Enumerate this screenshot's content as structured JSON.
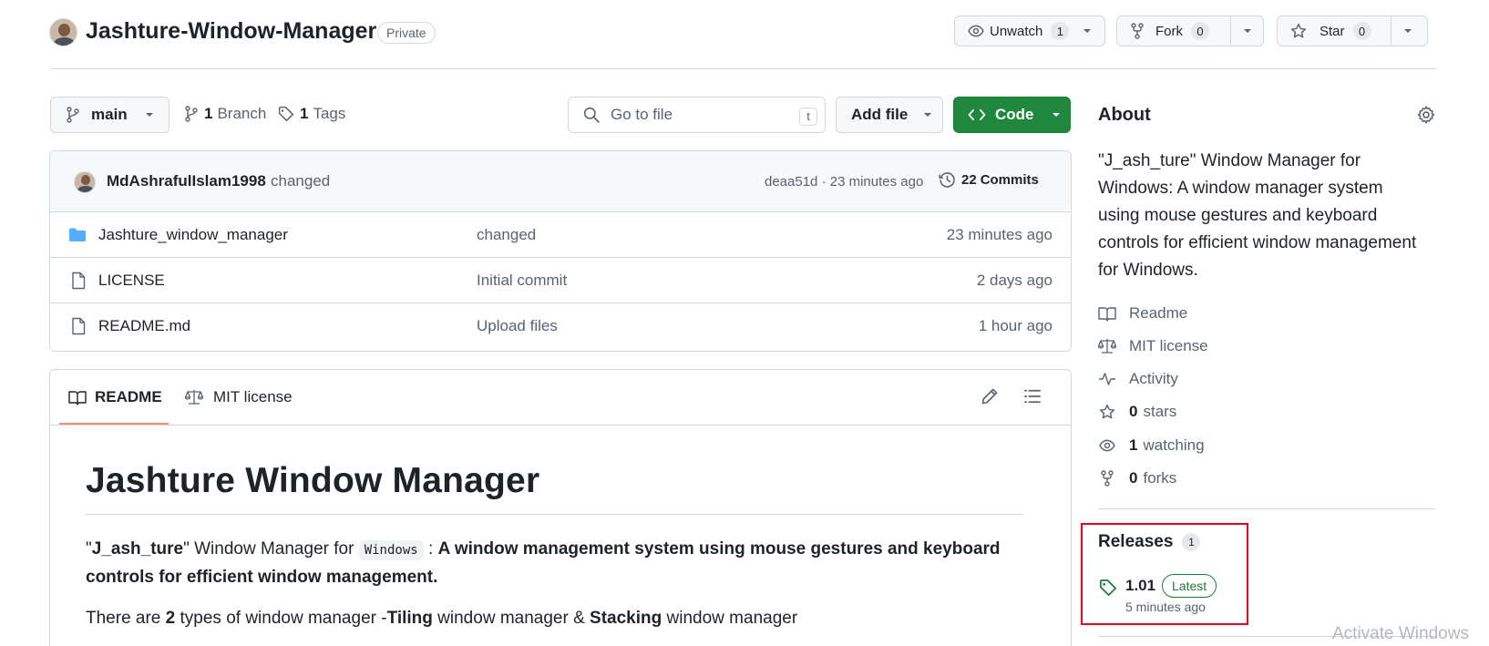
{
  "repo": {
    "name": "Jashture-Window-Manager",
    "visibility": "Private"
  },
  "actions": {
    "watch_label": "Unwatch",
    "watch_count": "1",
    "fork_label": "Fork",
    "fork_count": "0",
    "star_label": "Star",
    "star_count": "0"
  },
  "toolbar": {
    "branch": "main",
    "branches_count": "1",
    "branches_label": "Branch",
    "tags_count": "1",
    "tags_label": "Tags",
    "search_placeholder": "Go to file",
    "search_shortcut": "t",
    "add_file_label": "Add file",
    "code_label": "Code"
  },
  "commit": {
    "author": "MdAshrafulIslam1998",
    "message": "changed",
    "meta": "deaa51d · 23 minutes ago",
    "commits_count": "22",
    "commits_label": "Commits"
  },
  "files": [
    {
      "name": "Jashture_window_manager",
      "type": "folder",
      "message": "changed",
      "time": "23 minutes ago"
    },
    {
      "name": "LICENSE",
      "type": "file",
      "message": "Initial commit",
      "time": "2 days ago"
    },
    {
      "name": "README.md",
      "type": "file",
      "message": "Upload files",
      "time": "1 hour ago"
    }
  ],
  "readme_tabs": {
    "readme": "README",
    "license": "MIT license"
  },
  "readme": {
    "title": "Jashture Window Manager",
    "p1_prefix": "\"",
    "p1_bold1": "J_ash_ture",
    "p1_mid": "\" Window Manager for ",
    "p1_code": "Windows",
    "p1_colon": " : ",
    "p1_bold2": "A window management system using mouse gestures and keyboard controls for efficient window management.",
    "p2_a": "There are ",
    "p2_b": "2",
    "p2_c": " types of window manager -",
    "p2_d": "Tiling",
    "p2_e": " window manager & ",
    "p2_f": "Stacking",
    "p2_g": " window manager"
  },
  "about": {
    "heading": "About",
    "description": "\"J_ash_ture\" Window Manager for Windows: A window manager system using mouse gestures and keyboard controls for efficient window management for Windows.",
    "readme": "Readme",
    "license": "MIT license",
    "activity": "Activity",
    "stars_count": "0",
    "stars_label": "stars",
    "watching_count": "1",
    "watching_label": "watching",
    "forks_count": "0",
    "forks_label": "forks"
  },
  "releases": {
    "heading": "Releases",
    "count": "1",
    "version": "1.01",
    "badge": "Latest",
    "time": "5 minutes ago"
  },
  "watermark": "Activate Windows",
  "colors": {
    "accent_green": "#1f883d",
    "link_blue": "#0969da",
    "folder_blue": "#54aeff",
    "highlight_red": "#e0001b",
    "tab_underline": "#fd8c73"
  }
}
